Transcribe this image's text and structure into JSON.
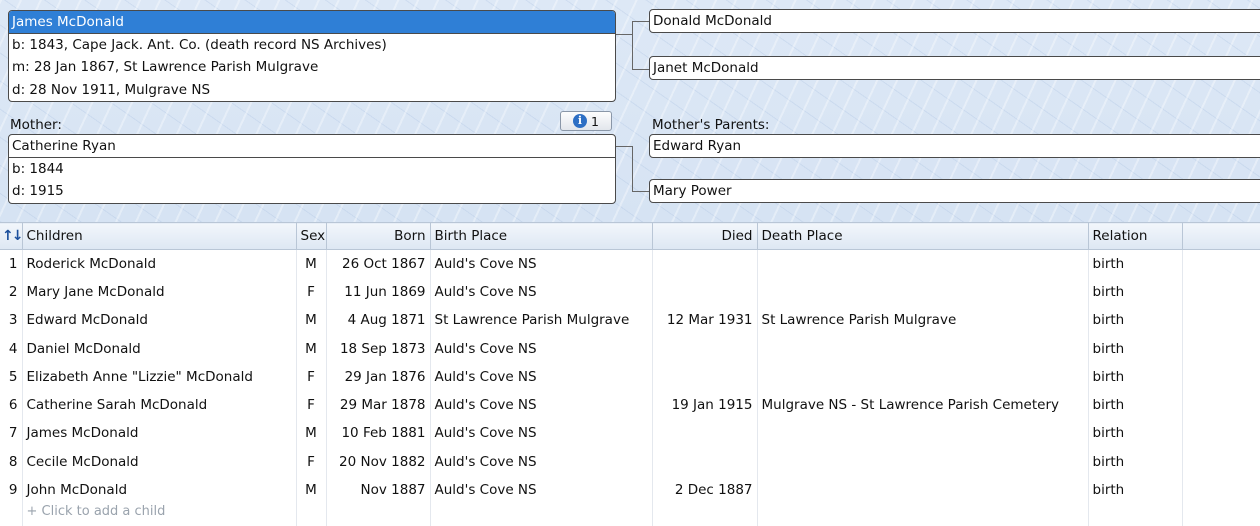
{
  "father": {
    "name": "James McDonald",
    "birth": "b: 1843, Cape Jack. Ant. Co. (death record NS Archives)",
    "marriage": "m: 28 Jan 1867, St Lawrence Parish Mulgrave",
    "death": "d: 28 Nov 1911, Mulgrave NS"
  },
  "father_parents": {
    "father": "Donald McDonald",
    "mother": "Janet McDonald"
  },
  "mother_label": "Mother:",
  "info_button": {
    "icon": "info-icon",
    "count": "1"
  },
  "mother": {
    "name": "Catherine Ryan",
    "birth": "b: 1844",
    "death": "d: 1915"
  },
  "mother_parents_label": "Mother's Parents:",
  "mother_parents": {
    "father": "Edward Ryan",
    "mother": "Mary Power"
  },
  "children_table": {
    "sort_icon": "sort-arrows-icon",
    "columns": [
      "Children",
      "Sex",
      "Born",
      "Birth Place",
      "Died",
      "Death Place",
      "Relation"
    ],
    "rows": [
      {
        "num": "1",
        "name": "Roderick McDonald",
        "sex": "M",
        "born": "26 Oct 1867",
        "birth_place": "Auld's Cove NS",
        "died": "",
        "death_place": "",
        "relation": "birth"
      },
      {
        "num": "2",
        "name": "Mary Jane McDonald",
        "sex": "F",
        "born": "11 Jun 1869",
        "birth_place": "Auld's Cove NS",
        "died": "",
        "death_place": "",
        "relation": "birth"
      },
      {
        "num": "3",
        "name": "Edward McDonald",
        "sex": "M",
        "born": "4 Aug 1871",
        "birth_place": "St Lawrence Parish Mulgrave",
        "died": "12 Mar 1931",
        "death_place": "St Lawrence Parish Mulgrave",
        "relation": "birth"
      },
      {
        "num": "4",
        "name": "Daniel McDonald",
        "sex": "M",
        "born": "18 Sep 1873",
        "birth_place": "Auld's Cove NS",
        "died": "",
        "death_place": "",
        "relation": "birth"
      },
      {
        "num": "5",
        "name": "Elizabeth Anne \"Lizzie\" McDonald",
        "sex": "F",
        "born": "29 Jan 1876",
        "birth_place": "Auld's Cove NS",
        "died": "",
        "death_place": "",
        "relation": "birth"
      },
      {
        "num": "6",
        "name": "Catherine Sarah McDonald",
        "sex": "F",
        "born": "29 Mar 1878",
        "birth_place": "Auld's Cove NS",
        "died": "19 Jan 1915",
        "death_place": "Mulgrave NS - St Lawrence Parish Cemetery",
        "relation": "birth"
      },
      {
        "num": "7",
        "name": "James McDonald",
        "sex": "M",
        "born": "10 Feb 1881",
        "birth_place": "Auld's Cove NS",
        "died": "",
        "death_place": "",
        "relation": "birth"
      },
      {
        "num": "8",
        "name": "Cecile McDonald",
        "sex": "F",
        "born": "20 Nov 1882",
        "birth_place": "Auld's Cove NS",
        "died": "",
        "death_place": "",
        "relation": "birth"
      },
      {
        "num": "9",
        "name": "John McDonald",
        "sex": "M",
        "born": "Nov 1887",
        "birth_place": "Auld's Cove NS",
        "died": "2 Dec 1887",
        "death_place": "",
        "relation": "birth"
      }
    ],
    "add_child": "+ Click to add a child"
  }
}
